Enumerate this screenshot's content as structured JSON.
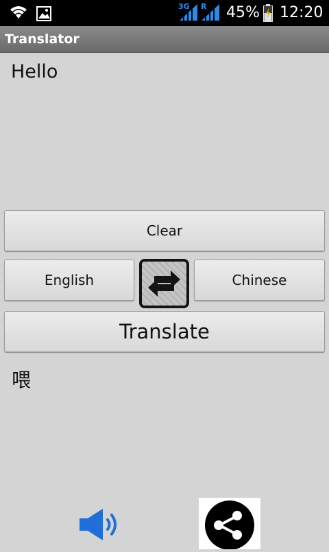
{
  "status_bar": {
    "network_label": "3G",
    "roaming_label": "R",
    "battery": "45%",
    "time": "12:20",
    "icons": [
      "wifi-icon",
      "image-icon",
      "signal-3g-icon",
      "signal-r-icon",
      "battery-charging-icon"
    ]
  },
  "app": {
    "title": "Translator"
  },
  "input": {
    "text": "Hello"
  },
  "buttons": {
    "clear": "Clear",
    "source_language": "English",
    "target_language": "Chinese",
    "translate": "Translate"
  },
  "output": {
    "text": "喂"
  },
  "colors": {
    "background": "#d4d4d4",
    "title_bar": "#7a7a7a",
    "speaker_accent": "#1e6fd9",
    "share_icon_background": "#000000"
  },
  "bottom_icons": [
    "speaker-icon",
    "share-icon"
  ]
}
